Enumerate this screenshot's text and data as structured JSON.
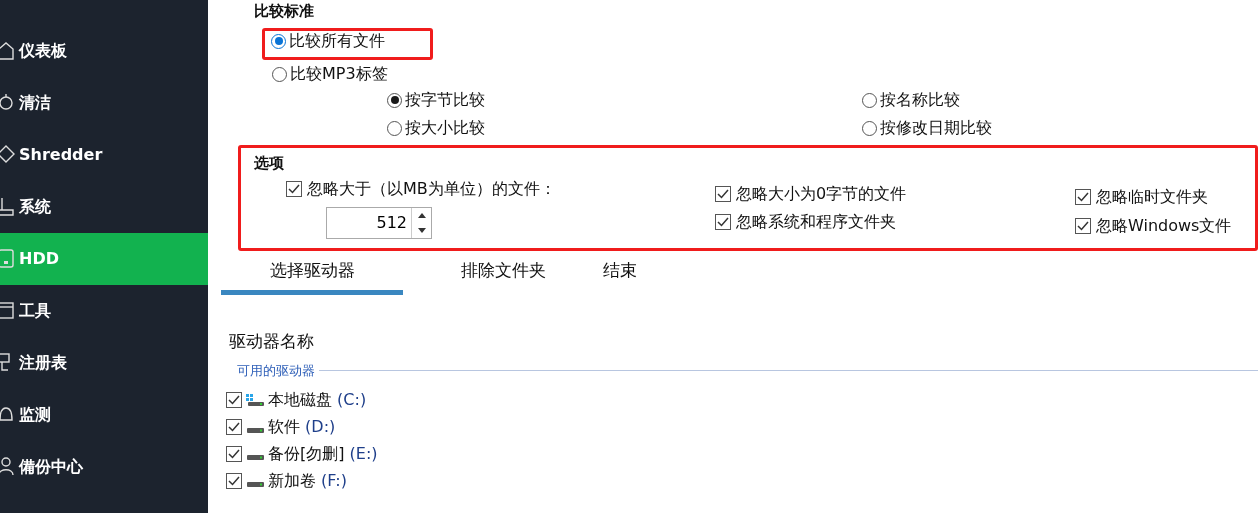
{
  "sidebar": {
    "items": [
      {
        "label": "仪表板",
        "selected": false
      },
      {
        "label": "清洁",
        "selected": false
      },
      {
        "label": "Shredder",
        "selected": false
      },
      {
        "label": "系统",
        "selected": false
      },
      {
        "label": "HDD",
        "selected": true
      },
      {
        "label": "工具",
        "selected": false
      },
      {
        "label": "注册表",
        "selected": false
      },
      {
        "label": "监测",
        "selected": false
      },
      {
        "label": "備份中心",
        "selected": false
      }
    ]
  },
  "compare": {
    "title": "比较标准",
    "highlighted": true,
    "modes": [
      {
        "label": "比较所有文件",
        "selected": true
      },
      {
        "label": "比较MP3标签",
        "selected": false
      }
    ],
    "methods": [
      {
        "label": "按字节比较",
        "selected": true
      },
      {
        "label": "按名称比较",
        "selected": false
      },
      {
        "label": "按大小比较",
        "selected": false
      },
      {
        "label": "按修改日期比较",
        "selected": false
      }
    ]
  },
  "options": {
    "title": "选项",
    "highlighted": true,
    "size_limit": {
      "label": "忽略大于（以MB为单位）的文件：",
      "checked": true,
      "value": "512"
    },
    "checks": [
      {
        "label": "忽略大小为0字节的文件",
        "checked": true
      },
      {
        "label": "忽略系统和程序文件夹",
        "checked": true
      },
      {
        "label": "忽略临时文件夹",
        "checked": true
      },
      {
        "label": "忽略Windows文件",
        "checked": true
      }
    ]
  },
  "tabs": [
    {
      "label": "选择驱动器",
      "selected": true
    },
    {
      "label": "排除文件夹",
      "selected": false
    },
    {
      "label": "结束",
      "selected": false
    }
  ],
  "drives": {
    "column": "驱动器名称",
    "group": "可用的驱动器",
    "items": [
      {
        "name": "本地磁盘",
        "letter": "(C:)",
        "checked": true,
        "kind": "system"
      },
      {
        "name": "软件",
        "letter": "(D:)",
        "checked": true,
        "kind": "disk"
      },
      {
        "name": "备份[勿删]",
        "letter": "(E:)",
        "checked": true,
        "kind": "disk"
      },
      {
        "name": "新加卷",
        "letter": "(F:)",
        "checked": true,
        "kind": "disk"
      }
    ]
  }
}
